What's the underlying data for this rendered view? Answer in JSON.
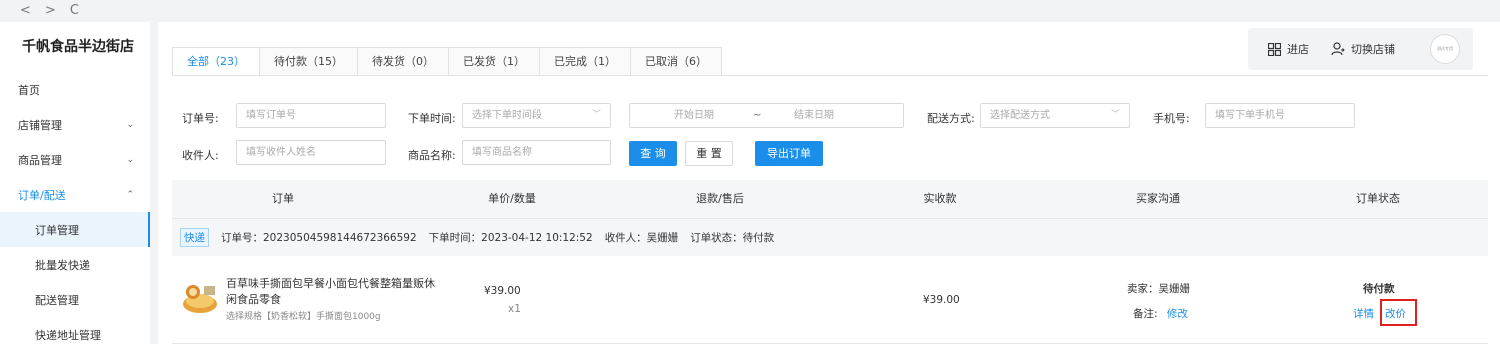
{
  "browser": {
    "back": "<",
    "forward": ">",
    "reload": "C"
  },
  "sidebar": {
    "store_name": "千帆食品半边街店",
    "items": [
      {
        "label": "首页",
        "chevron": ""
      },
      {
        "label": "店铺管理",
        "chevron": "⌄"
      },
      {
        "label": "商品管理",
        "chevron": "⌄"
      },
      {
        "label": "订单/配送",
        "chevron": "⌃"
      }
    ],
    "subitems": [
      {
        "label": "订单管理"
      },
      {
        "label": "批量发快递"
      },
      {
        "label": "配送管理"
      },
      {
        "label": "快递地址管理"
      }
    ]
  },
  "header": {
    "enter_store": "进店",
    "switch_store": "切换店铺",
    "avatar_text": "测试专用"
  },
  "tabs": [
    {
      "label": "全部（23）"
    },
    {
      "label": "待付款（15）"
    },
    {
      "label": "待发货（0）"
    },
    {
      "label": "已发货（1）"
    },
    {
      "label": "已完成（1）"
    },
    {
      "label": "已取消（6）"
    }
  ],
  "filters": {
    "order_no_label": "订单号:",
    "order_no_placeholder": "填写订单号",
    "time_label": "下单时间:",
    "time_placeholder": "选择下单时间段",
    "start_date": "开始日期",
    "date_sep": "~",
    "end_date": "结束日期",
    "delivery_label": "配送方式:",
    "delivery_placeholder": "选择配送方式",
    "phone_label": "手机号:",
    "phone_placeholder": "填写下单手机号",
    "receiver_label": "收件人:",
    "receiver_placeholder": "填写收件人姓名",
    "product_label": "商品名称:",
    "product_placeholder": "填写商品名称",
    "search_btn": "查 询",
    "reset_btn": "重 置",
    "export_btn": "导出订单"
  },
  "table": {
    "headers": [
      "订单",
      "单价/数量",
      "退款/售后",
      "实收款",
      "买家沟通",
      "订单状态"
    ]
  },
  "order": {
    "ship_type": "快递",
    "order_no": "订单号：2023050459814467236659​2",
    "order_time": "下单时间：2023-04-12 10:12:52",
    "receiver": "收件人：吴姗姗",
    "status_text": "订单状态：待付款",
    "product_name": "百草味手撕面包早餐小面包代餐整箱量贩休闲食品零食",
    "product_spec": "选择规格【奶香松软】手撕面包1000g",
    "unit_price": "¥39.00",
    "quantity": "x1",
    "received": "¥39.00",
    "buyer": "卖家：吴姗姗",
    "note_label": "备注:",
    "note_edit": "修改",
    "status": "待付款",
    "detail_link": "详情",
    "change_price_link": "改价"
  },
  "colors": {
    "accent": "#1a8ee8",
    "highlight": "#e02020"
  }
}
